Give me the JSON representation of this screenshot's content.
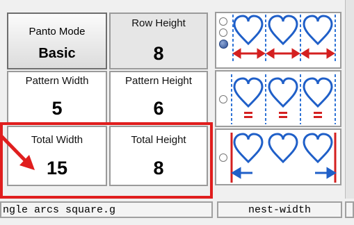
{
  "panto_mode": {
    "label": "Panto Mode",
    "value": "Basic"
  },
  "row_height": {
    "label": "Row Height",
    "value": "8"
  },
  "pattern_width": {
    "label": "Pattern Width",
    "value": "5"
  },
  "pattern_height": {
    "label": "Pattern Height",
    "value": "6"
  },
  "total_width": {
    "label": "Total Width",
    "value": "15"
  },
  "total_height": {
    "label": "Total Height",
    "value": "8"
  },
  "layout_options": {
    "names": [
      "row-height-spacing-pattern-icon",
      "pattern-width-height-pattern-icon",
      "total-width-pattern-icon"
    ]
  },
  "status_bar": {
    "filename": "ngle arcs square.g",
    "mode": "nest-width"
  },
  "colors": {
    "highlight_red": "#e01e1e",
    "icon_blue": "#1f5fc8",
    "dash_blue": "#2f73d6",
    "marker_red": "#d42020"
  }
}
